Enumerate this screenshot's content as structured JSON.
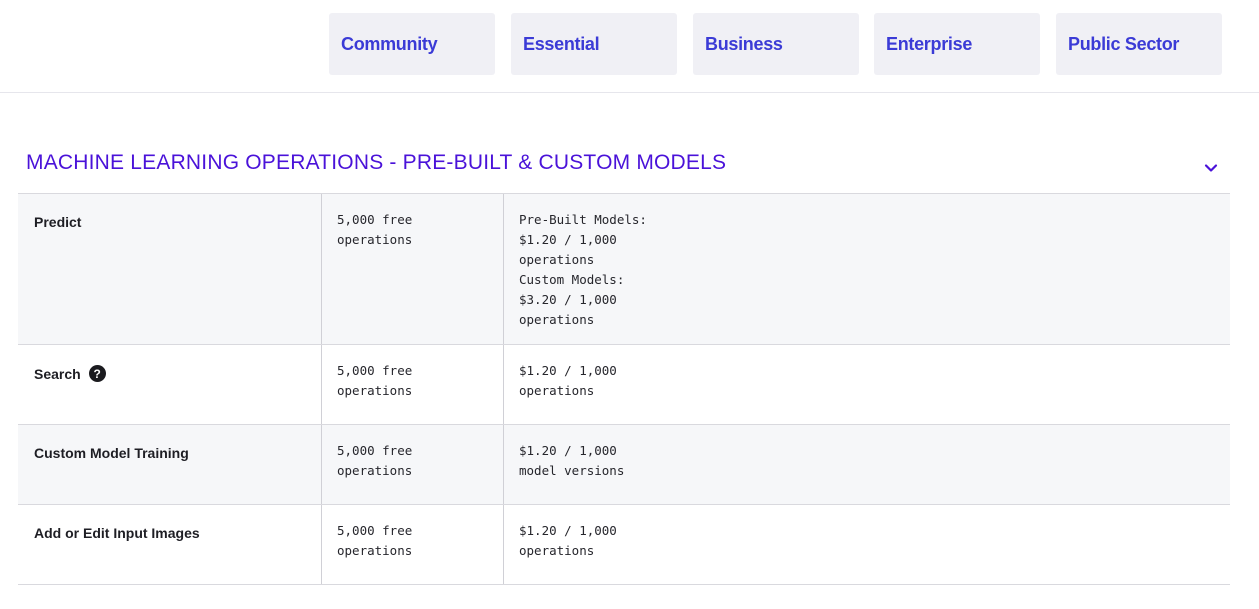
{
  "tabs": [
    "Community",
    "Essential",
    "Business",
    "Enterprise",
    "Public Sector"
  ],
  "section": {
    "title": "MACHINE LEARNING OPERATIONS - PRE-BUILT & CUSTOM MODELS",
    "accent_color": "#4a12d9"
  },
  "rows": [
    {
      "name": "Predict",
      "free": "5,000 free\noperations",
      "price": "Pre-Built Models:\n$1.20 / 1,000\noperations\nCustom Models:\n$3.20 / 1,000\noperations"
    },
    {
      "name": "Search",
      "help_icon": "question-circle-icon",
      "help_glyph": "?",
      "free": "5,000 free\noperations",
      "price": "$1.20 / 1,000\noperations"
    },
    {
      "name": "Custom Model Training",
      "free": "5,000 free\noperations",
      "price": "$1.20 / 1,000\nmodel versions"
    },
    {
      "name": "Add or Edit Input Images",
      "free": "5,000 free\noperations",
      "price": "$1.20 / 1,000\noperations"
    }
  ]
}
